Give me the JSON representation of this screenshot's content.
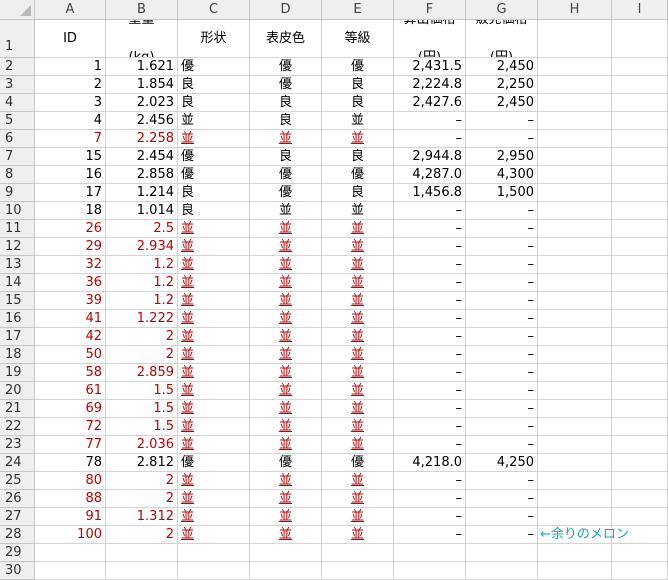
{
  "columns": [
    "A",
    "B",
    "C",
    "D",
    "E",
    "F",
    "G",
    "H",
    "I"
  ],
  "header_row": {
    "row_label": "1",
    "id": "ID",
    "weight": [
      "重量",
      "(kg)"
    ],
    "shape": "形状",
    "skin": "表皮色",
    "grade": "等級",
    "calc_price": [
      "算出価格",
      "(円)"
    ],
    "sale_price": [
      "販売価格",
      "(円)"
    ]
  },
  "rows": [
    {
      "row": "2",
      "id": "1",
      "weight": "1.621",
      "shape": "優",
      "skin": "優",
      "grade": "優",
      "calc": "2,431.5",
      "sale": "2,450",
      "red": false
    },
    {
      "row": "3",
      "id": "2",
      "weight": "1.854",
      "shape": "良",
      "skin": "優",
      "grade": "良",
      "calc": "2,224.8",
      "sale": "2,250",
      "red": false
    },
    {
      "row": "4",
      "id": "3",
      "weight": "2.023",
      "shape": "良",
      "skin": "良",
      "grade": "良",
      "calc": "2,427.6",
      "sale": "2,450",
      "red": false
    },
    {
      "row": "5",
      "id": "4",
      "weight": "2.456",
      "shape": "並",
      "skin": "良",
      "grade": "並",
      "calc": "–",
      "sale": "–",
      "red": false
    },
    {
      "row": "6",
      "id": "7",
      "weight": "2.258",
      "shape": "並",
      "skin": "並",
      "grade": "並",
      "calc": "–",
      "sale": "–",
      "red": true
    },
    {
      "row": "7",
      "id": "15",
      "weight": "2.454",
      "shape": "優",
      "skin": "良",
      "grade": "良",
      "calc": "2,944.8",
      "sale": "2,950",
      "red": false
    },
    {
      "row": "8",
      "id": "16",
      "weight": "2.858",
      "shape": "優",
      "skin": "優",
      "grade": "優",
      "calc": "4,287.0",
      "sale": "4,300",
      "red": false
    },
    {
      "row": "9",
      "id": "17",
      "weight": "1.214",
      "shape": "良",
      "skin": "優",
      "grade": "良",
      "calc": "1,456.8",
      "sale": "1,500",
      "red": false
    },
    {
      "row": "10",
      "id": "18",
      "weight": "1.014",
      "shape": "良",
      "skin": "並",
      "grade": "並",
      "calc": "–",
      "sale": "–",
      "red": false
    },
    {
      "row": "11",
      "id": "26",
      "weight": "2.5",
      "shape": "並",
      "skin": "並",
      "grade": "並",
      "calc": "–",
      "sale": "–",
      "red": true
    },
    {
      "row": "12",
      "id": "29",
      "weight": "2.934",
      "shape": "並",
      "skin": "並",
      "grade": "並",
      "calc": "–",
      "sale": "–",
      "red": true
    },
    {
      "row": "13",
      "id": "32",
      "weight": "1.2",
      "shape": "並",
      "skin": "並",
      "grade": "並",
      "calc": "–",
      "sale": "–",
      "red": true
    },
    {
      "row": "14",
      "id": "36",
      "weight": "1.2",
      "shape": "並",
      "skin": "並",
      "grade": "並",
      "calc": "–",
      "sale": "–",
      "red": true
    },
    {
      "row": "15",
      "id": "39",
      "weight": "1.2",
      "shape": "並",
      "skin": "並",
      "grade": "並",
      "calc": "–",
      "sale": "–",
      "red": true
    },
    {
      "row": "16",
      "id": "41",
      "weight": "1.222",
      "shape": "並",
      "skin": "並",
      "grade": "並",
      "calc": "–",
      "sale": "–",
      "red": true
    },
    {
      "row": "17",
      "id": "42",
      "weight": "2",
      "shape": "並",
      "skin": "並",
      "grade": "並",
      "calc": "–",
      "sale": "–",
      "red": true
    },
    {
      "row": "18",
      "id": "50",
      "weight": "2",
      "shape": "並",
      "skin": "並",
      "grade": "並",
      "calc": "–",
      "sale": "–",
      "red": true
    },
    {
      "row": "19",
      "id": "58",
      "weight": "2.859",
      "shape": "並",
      "skin": "並",
      "grade": "並",
      "calc": "–",
      "sale": "–",
      "red": true
    },
    {
      "row": "20",
      "id": "61",
      "weight": "1.5",
      "shape": "並",
      "skin": "並",
      "grade": "並",
      "calc": "–",
      "sale": "–",
      "red": true
    },
    {
      "row": "21",
      "id": "69",
      "weight": "1.5",
      "shape": "並",
      "skin": "並",
      "grade": "並",
      "calc": "–",
      "sale": "–",
      "red": true
    },
    {
      "row": "22",
      "id": "72",
      "weight": "1.5",
      "shape": "並",
      "skin": "並",
      "grade": "並",
      "calc": "–",
      "sale": "–",
      "red": true
    },
    {
      "row": "23",
      "id": "77",
      "weight": "2.036",
      "shape": "並",
      "skin": "並",
      "grade": "並",
      "calc": "–",
      "sale": "–",
      "red": true
    },
    {
      "row": "24",
      "id": "78",
      "weight": "2.812",
      "shape": "優",
      "skin": "優",
      "grade": "優",
      "calc": "4,218.0",
      "sale": "4,250",
      "red": false
    },
    {
      "row": "25",
      "id": "80",
      "weight": "2",
      "shape": "並",
      "skin": "並",
      "grade": "並",
      "calc": "–",
      "sale": "–",
      "red": true
    },
    {
      "row": "26",
      "id": "88",
      "weight": "2",
      "shape": "並",
      "skin": "並",
      "grade": "並",
      "calc": "–",
      "sale": "–",
      "red": true
    },
    {
      "row": "27",
      "id": "91",
      "weight": "1.312",
      "shape": "並",
      "skin": "並",
      "grade": "並",
      "calc": "–",
      "sale": "–",
      "red": true
    },
    {
      "row": "28",
      "id": "100",
      "weight": "2",
      "shape": "並",
      "skin": "並",
      "grade": "並",
      "calc": "–",
      "sale": "–",
      "red": true
    }
  ],
  "empty_rows": [
    "29",
    "30"
  ],
  "note": "←余りのメロン",
  "colors": {
    "red_text": "#c00000",
    "note_text": "#1aa0c8",
    "header_bg": "#efefef",
    "grid": "#d4d4d4"
  }
}
